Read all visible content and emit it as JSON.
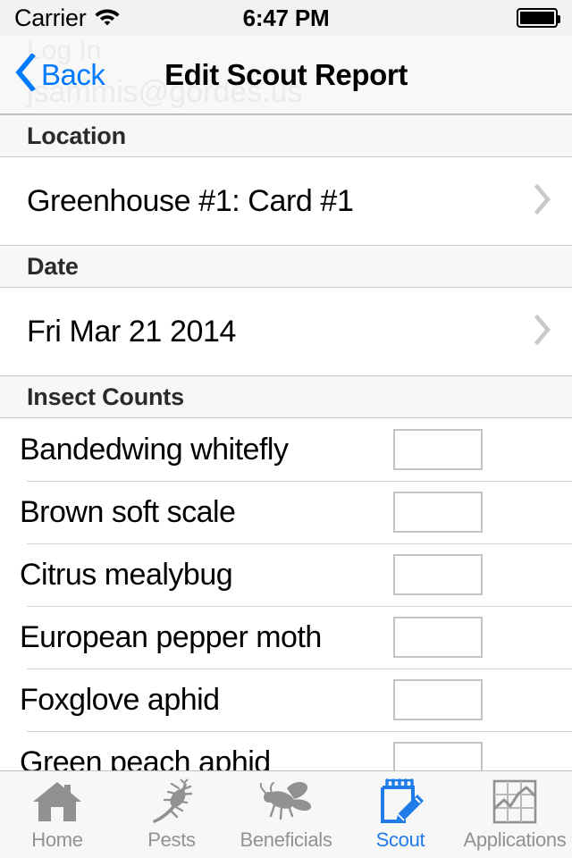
{
  "status_bar": {
    "carrier": "Carrier",
    "wifi_icon": "wifi-icon",
    "time": "6:47 PM",
    "battery_icon": "battery-full-icon"
  },
  "nav_bar": {
    "back_label": "Back",
    "back_icon": "chevron-left-icon",
    "title": "Edit Scout Report",
    "ghost_text_1": "Log In",
    "ghost_text_2": "jsammis@gordes.us"
  },
  "sections": [
    {
      "header": "Location",
      "rows": [
        {
          "label": "Greenhouse #1: Card #1",
          "accessory": "chevron-right-icon"
        }
      ]
    },
    {
      "header": "Date",
      "rows": [
        {
          "label": "Fri Mar 21 2014",
          "accessory": "chevron-right-icon"
        }
      ]
    }
  ],
  "insect_counts": {
    "header": "Insect Counts",
    "rows": [
      {
        "label": "Bandedwing whitefly",
        "value": "",
        "placeholder": ""
      },
      {
        "label": "Brown soft scale",
        "value": "",
        "placeholder": ""
      },
      {
        "label": "Citrus mealybug",
        "value": "",
        "placeholder": ""
      },
      {
        "label": "European pepper moth",
        "value": "",
        "placeholder": ""
      },
      {
        "label": "Foxglove aphid",
        "value": "",
        "placeholder": ""
      },
      {
        "label": "Green peach aphid",
        "value": "",
        "placeholder": ""
      }
    ]
  },
  "tab_bar": {
    "items": [
      {
        "label": "Home",
        "icon": "house-icon",
        "active": false
      },
      {
        "label": "Pests",
        "icon": "insect-icon",
        "active": false
      },
      {
        "label": "Beneficials",
        "icon": "bee-icon",
        "active": false
      },
      {
        "label": "Scout",
        "icon": "notepad-pencil-icon",
        "active": true
      },
      {
        "label": "Applications",
        "icon": "chart-grid-icon",
        "active": false
      }
    ]
  },
  "colors": {
    "accent_blue": "#007aff",
    "tab_active_blue": "#1f7ce8",
    "tab_inactive_gray": "#929292",
    "section_header_bg": "#f7f7f7",
    "field_border": "#c4c4c4"
  }
}
